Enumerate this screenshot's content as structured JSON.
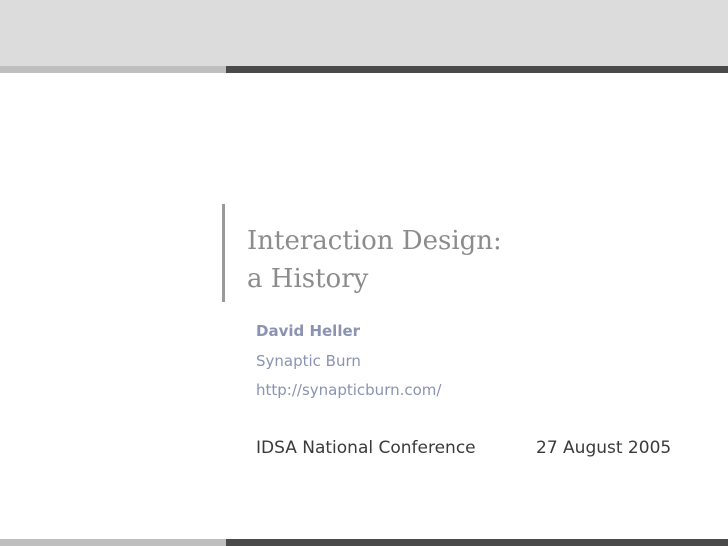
{
  "slide": {
    "title_line1": "Interaction Design:",
    "title_line2": "a History",
    "author": "David Heller",
    "organization": "Synaptic Burn",
    "url": "http://synapticburn.com/",
    "event": "IDSA National Conference",
    "date": "27 August 2005"
  },
  "colors": {
    "top_band": "#dcdcdc",
    "rule_light": "#bfbfbf",
    "rule_dark": "#4a4a4a",
    "title_text": "#8c8c8c",
    "author_text": "#8b93b3",
    "body_text": "#3a3a3a"
  }
}
